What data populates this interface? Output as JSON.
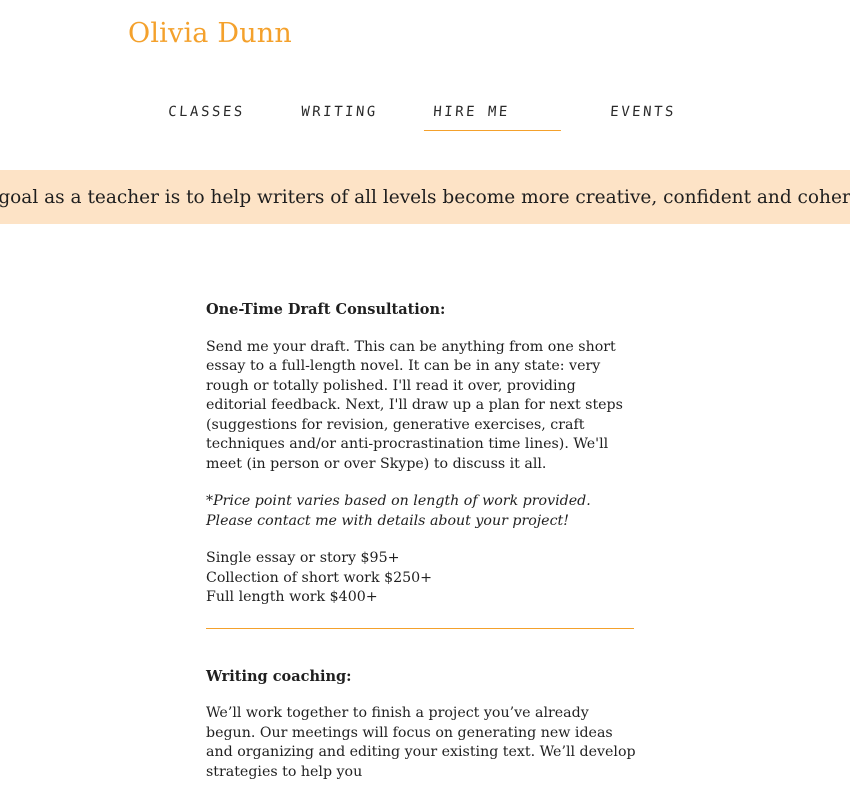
{
  "site": {
    "title": "Olivia Dunn"
  },
  "nav": {
    "items": [
      {
        "label": "Classes"
      },
      {
        "label": "Writing"
      },
      {
        "label": "Hire Me",
        "active": true
      },
      {
        "label": "Events"
      }
    ]
  },
  "banner": {
    "text": "My goal as a teacher is to help writers of all levels become more creative, confident and coherent."
  },
  "consultation": {
    "heading": "One-Time Draft Consultation:",
    "body": "Send me your draft. This can be anything from one short essay to a full-length novel. It can be in any state: very rough or totally polished. I'll read it over, providing editorial feedback. Next, I'll draw up a plan for next steps (suggestions for revision, generative exercises, craft techniques and/or anti-procrastination time lines). We'll meet (in person or over Skype) to discuss it all.",
    "note": "*Price point varies based on length of work provided. Please contact me with details about your project!",
    "prices": [
      "Single essay or story $95+",
      "Collection of short work $250+",
      "Full length work $400+"
    ]
  },
  "coaching": {
    "heading": "Writing coaching:",
    "body": "We’ll work together to finish a project you’ve already begun. Our meetings will focus on generating new ideas and organizing and editing your existing text. We’ll develop strategies to help you"
  },
  "colors": {
    "accent": "#f4a12c",
    "banner_bg": "#fde3c6"
  }
}
